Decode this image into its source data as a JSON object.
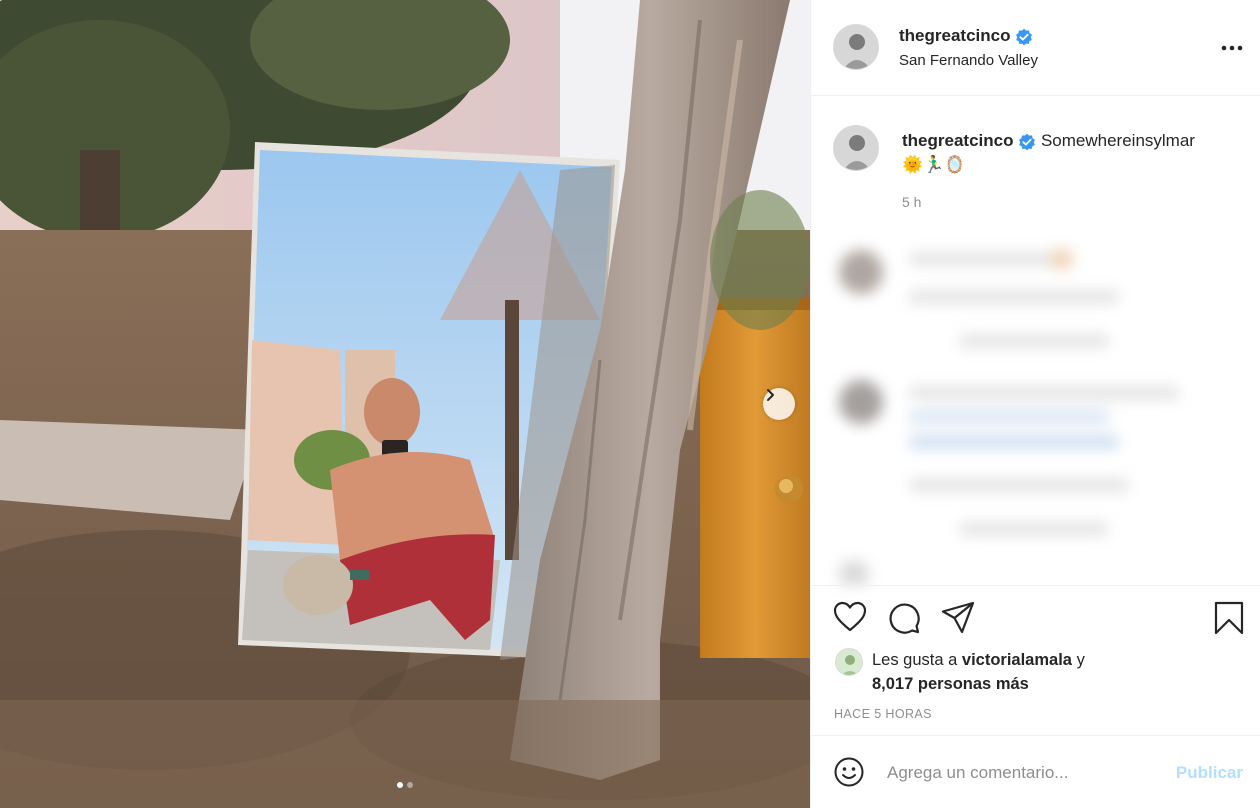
{
  "post": {
    "username": "thegreatcinco",
    "location": "San Fernando Valley",
    "caption": "Somewhereinsylmar",
    "caption_emoji": "🌞🏃‍♂️🪞",
    "caption_time": "5 h",
    "more_label": "•••"
  },
  "carousel": {
    "next_icon": "chevron-right-icon",
    "dots_count": 2,
    "active_dot": 0
  },
  "actions": {
    "icons": [
      "heart-icon",
      "comment-icon",
      "share-icon",
      "bookmark-icon"
    ]
  },
  "likes": {
    "prefix": "Les gusta a",
    "liker": "victorialamala",
    "connector": "y",
    "count_text": "8,017 personas más"
  },
  "timestamp": "HACE 5 HORAS",
  "comment_box": {
    "placeholder": "Agrega un comentario...",
    "publish_label": "Publicar"
  },
  "colors": {
    "verified": "#3897f0",
    "publish_disabled": "#b2dffc",
    "muted": "#8e8e8e",
    "text": "#262626",
    "border": "#efefef"
  }
}
